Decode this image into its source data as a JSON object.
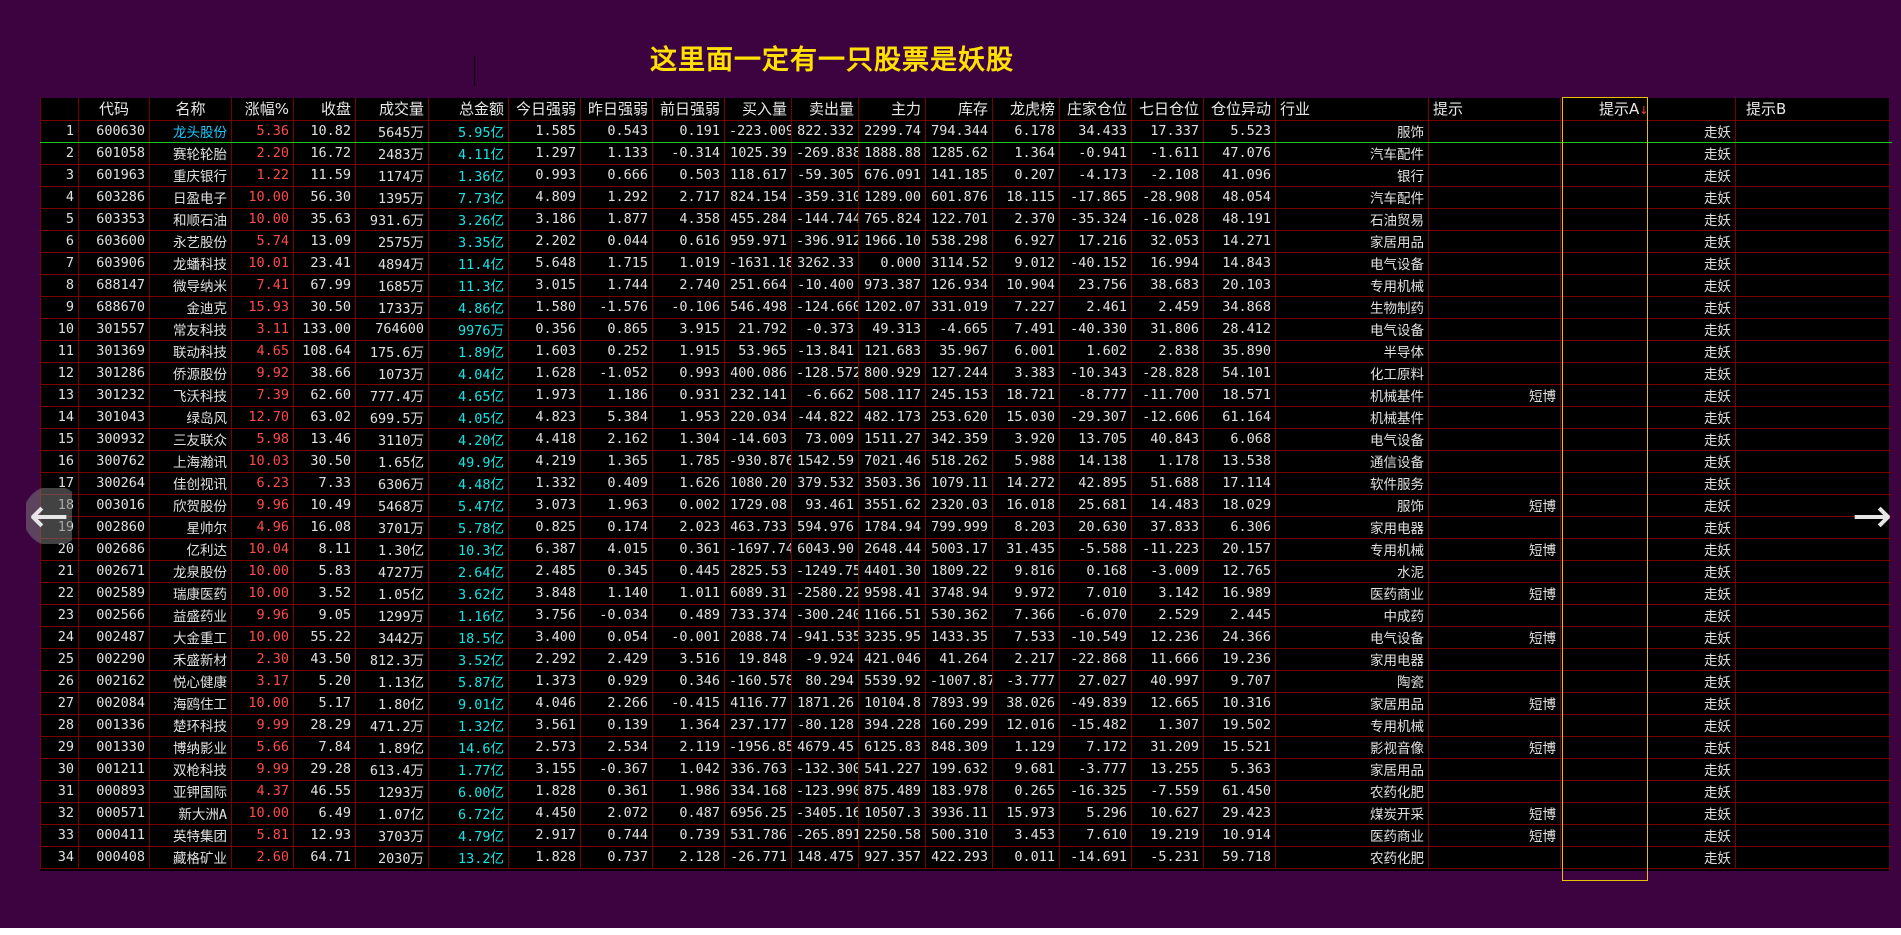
{
  "page": {
    "title": "这里面一定有一只股票是妖股",
    "nav_prev": "←",
    "nav_next": "→"
  },
  "columns": {
    "idx": "",
    "code": "代码",
    "name": "名称",
    "chg": "涨幅%",
    "close": "收盘",
    "vol": "成交量",
    "amount": "总金额",
    "today": "今日强弱",
    "yest": "昨日强弱",
    "prev": "前日强弱",
    "buy": "买入量",
    "sell": "卖出量",
    "main": "主力",
    "stock": "库存",
    "dragon": "龙虎榜",
    "bank": "庄家仓位",
    "seven": "七日仓位",
    "move": "仓位异动",
    "ind": "行业",
    "tip": "提示",
    "tipa": "提示A",
    "tipa_sort": "↓",
    "tipb": "提示B"
  },
  "rows": [
    {
      "i": "1",
      "code": "600630",
      "name": "龙头股份",
      "chg": "5.36",
      "close": "10.82",
      "vol": "5645万",
      "amount": "5.95亿",
      "today": "1.585",
      "yest": "0.543",
      "prev": "0.191",
      "buy": "-223.009",
      "sell": "822.332",
      "main": "2299.74",
      "stock": "794.344",
      "dragon": "6.178",
      "bank": "34.433",
      "seven": "17.337",
      "move": "5.523",
      "ind": "服饰",
      "tip": "",
      "tipa": "走妖",
      "tipb": ""
    },
    {
      "i": "2",
      "code": "601058",
      "name": "赛轮轮胎",
      "chg": "2.20",
      "close": "16.72",
      "vol": "2483万",
      "amount": "4.11亿",
      "today": "1.297",
      "yest": "1.133",
      "prev": "-0.314",
      "buy": "1025.39",
      "sell": "-269.838",
      "main": "1888.88",
      "stock": "1285.62",
      "dragon": "1.364",
      "bank": "-0.941",
      "seven": "-1.611",
      "move": "47.076",
      "ind": "汽车配件",
      "tip": "",
      "tipa": "走妖",
      "tipb": ""
    },
    {
      "i": "3",
      "code": "601963",
      "name": "重庆银行",
      "chg": "1.22",
      "close": "11.59",
      "vol": "1174万",
      "amount": "1.36亿",
      "today": "0.993",
      "yest": "0.666",
      "prev": "0.503",
      "buy": "118.617",
      "sell": "-59.305",
      "main": "676.091",
      "stock": "141.185",
      "dragon": "0.207",
      "bank": "-4.173",
      "seven": "-2.108",
      "move": "41.096",
      "ind": "银行",
      "tip": "",
      "tipa": "走妖",
      "tipb": ""
    },
    {
      "i": "4",
      "code": "603286",
      "name": "日盈电子",
      "chg": "10.00",
      "close": "56.30",
      "vol": "1395万",
      "amount": "7.73亿",
      "today": "4.809",
      "yest": "1.292",
      "prev": "2.717",
      "buy": "824.154",
      "sell": "-359.310",
      "main": "1289.00",
      "stock": "601.876",
      "dragon": "18.115",
      "bank": "-17.865",
      "seven": "-28.908",
      "move": "48.054",
      "ind": "汽车配件",
      "tip": "",
      "tipa": "走妖",
      "tipb": ""
    },
    {
      "i": "5",
      "code": "603353",
      "name": "和顺石油",
      "chg": "10.00",
      "close": "35.63",
      "vol": "931.6万",
      "amount": "3.26亿",
      "today": "3.186",
      "yest": "1.877",
      "prev": "4.358",
      "buy": "455.284",
      "sell": "-144.744",
      "main": "765.824",
      "stock": "122.701",
      "dragon": "2.370",
      "bank": "-35.324",
      "seven": "-16.028",
      "move": "48.191",
      "ind": "石油贸易",
      "tip": "",
      "tipa": "走妖",
      "tipb": ""
    },
    {
      "i": "6",
      "code": "603600",
      "name": "永艺股份",
      "chg": "5.74",
      "close": "13.09",
      "vol": "2575万",
      "amount": "3.35亿",
      "today": "2.202",
      "yest": "0.044",
      "prev": "0.616",
      "buy": "959.971",
      "sell": "-396.912",
      "main": "1966.10",
      "stock": "538.298",
      "dragon": "6.927",
      "bank": "17.216",
      "seven": "32.053",
      "move": "14.271",
      "ind": "家居用品",
      "tip": "",
      "tipa": "走妖",
      "tipb": ""
    },
    {
      "i": "7",
      "code": "603906",
      "name": "龙蟠科技",
      "chg": "10.01",
      "close": "23.41",
      "vol": "4894万",
      "amount": "11.4亿",
      "today": "5.648",
      "yest": "1.715",
      "prev": "1.019",
      "buy": "-1631.18",
      "sell": "3262.33",
      "main": "0.000",
      "stock": "3114.52",
      "dragon": "9.012",
      "bank": "-40.152",
      "seven": "16.994",
      "move": "14.843",
      "ind": "电气设备",
      "tip": "",
      "tipa": "走妖",
      "tipb": ""
    },
    {
      "i": "8",
      "code": "688147",
      "name": "微导纳米",
      "chg": "7.41",
      "close": "67.99",
      "vol": "1685万",
      "amount": "11.3亿",
      "today": "3.015",
      "yest": "1.744",
      "prev": "2.740",
      "buy": "251.664",
      "sell": "-10.400",
      "main": "973.387",
      "stock": "126.934",
      "dragon": "10.904",
      "bank": "23.756",
      "seven": "38.683",
      "move": "20.103",
      "ind": "专用机械",
      "tip": "",
      "tipa": "走妖",
      "tipb": ""
    },
    {
      "i": "9",
      "code": "688670",
      "name": "金迪克",
      "chg": "15.93",
      "close": "30.50",
      "vol": "1733万",
      "amount": "4.86亿",
      "today": "1.580",
      "yest": "-1.576",
      "prev": "-0.106",
      "buy": "546.498",
      "sell": "-124.660",
      "main": "1202.07",
      "stock": "331.019",
      "dragon": "7.227",
      "bank": "2.461",
      "seven": "2.459",
      "move": "34.868",
      "ind": "生物制药",
      "tip": "",
      "tipa": "走妖",
      "tipb": ""
    },
    {
      "i": "10",
      "code": "301557",
      "name": "常友科技",
      "chg": "3.11",
      "close": "133.00",
      "vol": "764600",
      "amount": "9976万",
      "today": "0.356",
      "yest": "0.865",
      "prev": "3.915",
      "buy": "21.792",
      "sell": "-0.373",
      "main": "49.313",
      "stock": "-4.665",
      "dragon": "7.491",
      "bank": "-40.330",
      "seven": "31.806",
      "move": "28.412",
      "ind": "电气设备",
      "tip": "",
      "tipa": "走妖",
      "tipb": ""
    },
    {
      "i": "11",
      "code": "301369",
      "name": "联动科技",
      "chg": "4.65",
      "close": "108.64",
      "vol": "175.6万",
      "amount": "1.89亿",
      "today": "1.603",
      "yest": "0.252",
      "prev": "1.915",
      "buy": "53.965",
      "sell": "-13.841",
      "main": "121.683",
      "stock": "35.967",
      "dragon": "6.001",
      "bank": "1.602",
      "seven": "2.838",
      "move": "35.890",
      "ind": "半导体",
      "tip": "",
      "tipa": "走妖",
      "tipb": ""
    },
    {
      "i": "12",
      "code": "301286",
      "name": "侨源股份",
      "chg": "9.92",
      "close": "38.66",
      "vol": "1073万",
      "amount": "4.04亿",
      "today": "1.628",
      "yest": "-1.052",
      "prev": "0.993",
      "buy": "400.086",
      "sell": "-128.572",
      "main": "800.929",
      "stock": "127.244",
      "dragon": "3.383",
      "bank": "-10.343",
      "seven": "-28.828",
      "move": "54.101",
      "ind": "化工原料",
      "tip": "",
      "tipa": "走妖",
      "tipb": ""
    },
    {
      "i": "13",
      "code": "301232",
      "name": "飞沃科技",
      "chg": "7.39",
      "close": "62.60",
      "vol": "777.4万",
      "amount": "4.65亿",
      "today": "1.973",
      "yest": "1.186",
      "prev": "0.931",
      "buy": "232.141",
      "sell": "-6.662",
      "main": "508.117",
      "stock": "245.153",
      "dragon": "18.721",
      "bank": "-8.777",
      "seven": "-11.700",
      "move": "18.571",
      "ind": "机械基件",
      "tip": "短博",
      "tipa": "走妖",
      "tipb": ""
    },
    {
      "i": "14",
      "code": "301043",
      "name": "绿岛风",
      "chg": "12.70",
      "close": "63.02",
      "vol": "699.5万",
      "amount": "4.05亿",
      "today": "4.823",
      "yest": "5.384",
      "prev": "1.953",
      "buy": "220.034",
      "sell": "-44.822",
      "main": "482.173",
      "stock": "253.620",
      "dragon": "15.030",
      "bank": "-29.307",
      "seven": "-12.606",
      "move": "61.164",
      "ind": "机械基件",
      "tip": "",
      "tipa": "走妖",
      "tipb": ""
    },
    {
      "i": "15",
      "code": "300932",
      "name": "三友联众",
      "chg": "5.98",
      "close": "13.46",
      "vol": "3110万",
      "amount": "4.20亿",
      "today": "4.418",
      "yest": "2.162",
      "prev": "1.304",
      "buy": "-14.603",
      "sell": "73.009",
      "main": "1511.27",
      "stock": "342.359",
      "dragon": "3.920",
      "bank": "13.705",
      "seven": "40.843",
      "move": "6.068",
      "ind": "电气设备",
      "tip": "",
      "tipa": "走妖",
      "tipb": ""
    },
    {
      "i": "16",
      "code": "300762",
      "name": "上海瀚讯",
      "chg": "10.03",
      "close": "30.50",
      "vol": "1.65亿",
      "amount": "49.9亿",
      "today": "4.219",
      "yest": "1.365",
      "prev": "1.785",
      "buy": "-930.876",
      "sell": "1542.59",
      "main": "7021.46",
      "stock": "518.262",
      "dragon": "5.988",
      "bank": "14.138",
      "seven": "1.178",
      "move": "13.538",
      "ind": "通信设备",
      "tip": "",
      "tipa": "走妖",
      "tipb": ""
    },
    {
      "i": "17",
      "code": "300264",
      "name": "佳创视讯",
      "chg": "6.23",
      "close": "7.33",
      "vol": "6306万",
      "amount": "4.48亿",
      "today": "1.332",
      "yest": "0.409",
      "prev": "1.626",
      "buy": "1080.20",
      "sell": "379.532",
      "main": "3503.36",
      "stock": "1079.11",
      "dragon": "14.272",
      "bank": "42.895",
      "seven": "51.688",
      "move": "17.114",
      "ind": "软件服务",
      "tip": "",
      "tipa": "走妖",
      "tipb": ""
    },
    {
      "i": "18",
      "code": "003016",
      "name": "欣贺股份",
      "chg": "9.96",
      "close": "10.49",
      "vol": "5468万",
      "amount": "5.47亿",
      "today": "3.073",
      "yest": "1.963",
      "prev": "0.002",
      "buy": "1729.08",
      "sell": "93.461",
      "main": "3551.62",
      "stock": "2320.03",
      "dragon": "16.018",
      "bank": "25.681",
      "seven": "14.483",
      "move": "18.029",
      "ind": "服饰",
      "tip": "短博",
      "tipa": "走妖",
      "tipb": ""
    },
    {
      "i": "19",
      "code": "002860",
      "name": "星帅尔",
      "chg": "4.96",
      "close": "16.08",
      "vol": "3701万",
      "amount": "5.78亿",
      "today": "0.825",
      "yest": "0.174",
      "prev": "2.023",
      "buy": "463.733",
      "sell": "594.976",
      "main": "1784.94",
      "stock": "799.999",
      "dragon": "8.203",
      "bank": "20.630",
      "seven": "37.833",
      "move": "6.306",
      "ind": "家用电器",
      "tip": "",
      "tipa": "走妖",
      "tipb": ""
    },
    {
      "i": "20",
      "code": "002686",
      "name": "亿利达",
      "chg": "10.04",
      "close": "8.11",
      "vol": "1.30亿",
      "amount": "10.3亿",
      "today": "6.387",
      "yest": "4.015",
      "prev": "0.361",
      "buy": "-1697.74",
      "sell": "6043.90",
      "main": "2648.44",
      "stock": "5003.17",
      "dragon": "31.435",
      "bank": "-5.588",
      "seven": "-11.223",
      "move": "20.157",
      "ind": "专用机械",
      "tip": "短博",
      "tipa": "走妖",
      "tipb": ""
    },
    {
      "i": "21",
      "code": "002671",
      "name": "龙泉股份",
      "chg": "10.00",
      "close": "5.83",
      "vol": "4727万",
      "amount": "2.64亿",
      "today": "2.485",
      "yest": "0.345",
      "prev": "0.445",
      "buy": "2825.53",
      "sell": "-1249.75",
      "main": "4401.30",
      "stock": "1809.22",
      "dragon": "9.816",
      "bank": "0.168",
      "seven": "-3.009",
      "move": "12.765",
      "ind": "水泥",
      "tip": "",
      "tipa": "走妖",
      "tipb": ""
    },
    {
      "i": "22",
      "code": "002589",
      "name": "瑞康医药",
      "chg": "10.00",
      "close": "3.52",
      "vol": "1.05亿",
      "amount": "3.62亿",
      "today": "3.848",
      "yest": "1.140",
      "prev": "1.011",
      "buy": "6089.31",
      "sell": "-2580.22",
      "main": "9598.41",
      "stock": "3748.94",
      "dragon": "9.972",
      "bank": "7.010",
      "seven": "3.142",
      "move": "16.989",
      "ind": "医药商业",
      "tip": "短博",
      "tipa": "走妖",
      "tipb": ""
    },
    {
      "i": "23",
      "code": "002566",
      "name": "益盛药业",
      "chg": "9.96",
      "close": "9.05",
      "vol": "1299万",
      "amount": "1.16亿",
      "today": "3.756",
      "yest": "-0.034",
      "prev": "0.489",
      "buy": "733.374",
      "sell": "-300.240",
      "main": "1166.51",
      "stock": "530.362",
      "dragon": "7.366",
      "bank": "-6.070",
      "seven": "2.529",
      "move": "2.445",
      "ind": "中成药",
      "tip": "",
      "tipa": "走妖",
      "tipb": ""
    },
    {
      "i": "24",
      "code": "002487",
      "name": "大金重工",
      "chg": "10.00",
      "close": "55.22",
      "vol": "3442万",
      "amount": "18.5亿",
      "today": "3.400",
      "yest": "0.054",
      "prev": "-0.001",
      "buy": "2088.74",
      "sell": "-941.535",
      "main": "3235.95",
      "stock": "1433.35",
      "dragon": "7.533",
      "bank": "-10.549",
      "seven": "12.236",
      "move": "24.366",
      "ind": "电气设备",
      "tip": "短博",
      "tipa": "走妖",
      "tipb": ""
    },
    {
      "i": "25",
      "code": "002290",
      "name": "禾盛新材",
      "chg": "2.30",
      "close": "43.50",
      "vol": "812.3万",
      "amount": "3.52亿",
      "today": "2.292",
      "yest": "2.429",
      "prev": "3.516",
      "buy": "19.848",
      "sell": "-9.924",
      "main": "421.046",
      "stock": "41.264",
      "dragon": "2.217",
      "bank": "-22.868",
      "seven": "11.666",
      "move": "19.236",
      "ind": "家用电器",
      "tip": "",
      "tipa": "走妖",
      "tipb": ""
    },
    {
      "i": "26",
      "code": "002162",
      "name": "悦心健康",
      "chg": "3.17",
      "close": "5.20",
      "vol": "1.13亿",
      "amount": "5.87亿",
      "today": "1.373",
      "yest": "0.929",
      "prev": "0.346",
      "buy": "-160.578",
      "sell": "80.294",
      "main": "5539.92",
      "stock": "-1007.87",
      "dragon": "-3.777",
      "bank": "27.027",
      "seven": "40.997",
      "move": "9.707",
      "ind": "陶瓷",
      "tip": "",
      "tipa": "走妖",
      "tipb": ""
    },
    {
      "i": "27",
      "code": "002084",
      "name": "海鸥住工",
      "chg": "10.00",
      "close": "5.17",
      "vol": "1.80亿",
      "amount": "9.01亿",
      "today": "4.046",
      "yest": "2.266",
      "prev": "-0.415",
      "buy": "4116.77",
      "sell": "1871.26",
      "main": "10104.8",
      "stock": "7893.99",
      "dragon": "38.026",
      "bank": "-49.839",
      "seven": "12.665",
      "move": "10.316",
      "ind": "家居用品",
      "tip": "短博",
      "tipa": "走妖",
      "tipb": ""
    },
    {
      "i": "28",
      "code": "001336",
      "name": "楚环科技",
      "chg": "9.99",
      "close": "28.29",
      "vol": "471.2万",
      "amount": "1.32亿",
      "today": "3.561",
      "yest": "0.139",
      "prev": "1.364",
      "buy": "237.177",
      "sell": "-80.128",
      "main": "394.228",
      "stock": "160.299",
      "dragon": "12.016",
      "bank": "-15.482",
      "seven": "1.307",
      "move": "19.502",
      "ind": "专用机械",
      "tip": "",
      "tipa": "走妖",
      "tipb": ""
    },
    {
      "i": "29",
      "code": "001330",
      "name": "博纳影业",
      "chg": "5.66",
      "close": "7.84",
      "vol": "1.89亿",
      "amount": "14.6亿",
      "today": "2.573",
      "yest": "2.534",
      "prev": "2.119",
      "buy": "-1956.85",
      "sell": "4679.45",
      "main": "6125.83",
      "stock": "848.309",
      "dragon": "1.129",
      "bank": "7.172",
      "seven": "31.209",
      "move": "15.521",
      "ind": "影视音像",
      "tip": "短博",
      "tipa": "走妖",
      "tipb": ""
    },
    {
      "i": "30",
      "code": "001211",
      "name": "双枪科技",
      "chg": "9.99",
      "close": "29.28",
      "vol": "613.4万",
      "amount": "1.77亿",
      "today": "3.155",
      "yest": "-0.367",
      "prev": "1.042",
      "buy": "336.763",
      "sell": "-132.300",
      "main": "541.227",
      "stock": "199.632",
      "dragon": "9.681",
      "bank": "-3.777",
      "seven": "13.255",
      "move": "5.363",
      "ind": "家居用品",
      "tip": "",
      "tipa": "走妖",
      "tipb": ""
    },
    {
      "i": "31",
      "code": "000893",
      "name": "亚钾国际",
      "chg": "4.37",
      "close": "46.55",
      "vol": "1293万",
      "amount": "6.00亿",
      "today": "1.828",
      "yest": "0.361",
      "prev": "1.986",
      "buy": "334.168",
      "sell": "-123.990",
      "main": "875.489",
      "stock": "183.978",
      "dragon": "0.265",
      "bank": "-16.325",
      "seven": "-7.559",
      "move": "61.450",
      "ind": "农药化肥",
      "tip": "",
      "tipa": "走妖",
      "tipb": ""
    },
    {
      "i": "32",
      "code": "000571",
      "name": "新大洲A",
      "chg": "10.00",
      "close": "6.49",
      "vol": "1.07亿",
      "amount": "6.72亿",
      "today": "4.450",
      "yest": "2.072",
      "prev": "0.487",
      "buy": "6956.25",
      "sell": "-3405.16",
      "main": "10507.3",
      "stock": "3936.11",
      "dragon": "15.973",
      "bank": "5.296",
      "seven": "10.627",
      "move": "29.423",
      "ind": "煤炭开采",
      "tip": "短博",
      "tipa": "走妖",
      "tipb": ""
    },
    {
      "i": "33",
      "code": "000411",
      "name": "英特集团",
      "chg": "5.81",
      "close": "12.93",
      "vol": "3703万",
      "amount": "4.79亿",
      "today": "2.917",
      "yest": "0.744",
      "prev": "0.739",
      "buy": "531.786",
      "sell": "-265.891",
      "main": "2250.58",
      "stock": "500.310",
      "dragon": "3.453",
      "bank": "7.610",
      "seven": "19.219",
      "move": "10.914",
      "ind": "医药商业",
      "tip": "短博",
      "tipa": "走妖",
      "tipb": ""
    },
    {
      "i": "34",
      "code": "000408",
      "name": "藏格矿业",
      "chg": "2.60",
      "close": "64.71",
      "vol": "2030万",
      "amount": "13.2亿",
      "today": "1.828",
      "yest": "0.737",
      "prev": "2.128",
      "buy": "-26.771",
      "sell": "148.475",
      "main": "927.357",
      "stock": "422.293",
      "dragon": "0.011",
      "bank": "-14.691",
      "seven": "-5.231",
      "move": "59.718",
      "ind": "农药化肥",
      "tip": "",
      "tipa": "走妖",
      "tipb": ""
    }
  ]
}
